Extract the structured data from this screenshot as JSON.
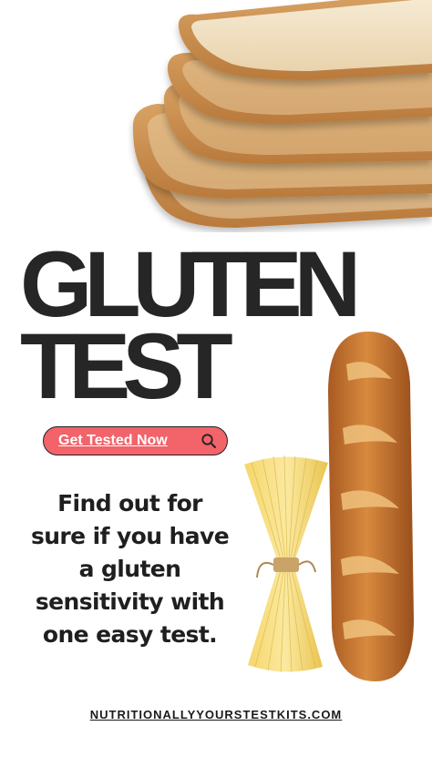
{
  "headline": {
    "line1": "GLUTEN",
    "line2": "TEST"
  },
  "cta": {
    "label": "Get Tested Now",
    "icon": "search-icon"
  },
  "body_text": "Find out for sure if you have a gluten sensitivity with one easy test.",
  "footer": {
    "link_text": "NUTRITIONALLYYOURSTESTKITS.COM"
  },
  "images": {
    "top": "bread-slices-image",
    "bottom_left": "spaghetti-bundle-image",
    "bottom_right": "baguette-image"
  },
  "colors": {
    "accent": "#f2636a",
    "headline": "#262626",
    "text": "#1f1f1f",
    "background": "#ffffff"
  }
}
